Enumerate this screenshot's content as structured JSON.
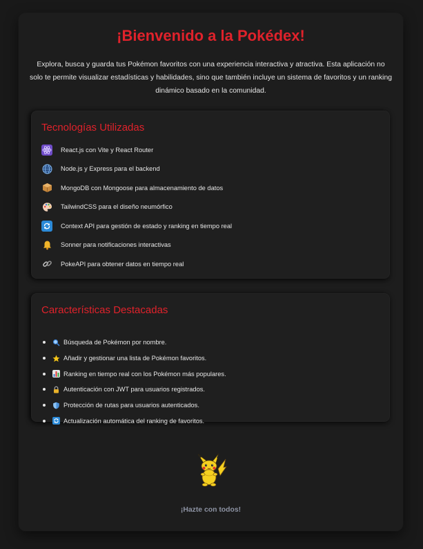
{
  "header": {
    "title": "¡Bienvenido a la Pokédex!",
    "intro": "Explora, busca y guarda tus Pokémon favoritos con una experiencia interactiva y atractiva. Esta aplicación no solo te permite visualizar estadísticas y habilidades, sino que también incluye un sistema de favoritos y un ranking dinámico basado en la comunidad."
  },
  "technologies": {
    "title": "Tecnologías Utilizadas",
    "items": [
      {
        "icon": "react-atom-icon",
        "text": "React.js con Vite y React Router"
      },
      {
        "icon": "globe-icon",
        "text": "Node.js y Express para el backend"
      },
      {
        "icon": "package-icon",
        "text": "MongoDB con Mongoose para almacenamiento de datos"
      },
      {
        "icon": "palette-icon",
        "text": "TailwindCSS para el diseño neumórfico"
      },
      {
        "icon": "refresh-icon",
        "text": "Context API para gestión de estado y ranking en tiempo real"
      },
      {
        "icon": "bell-icon",
        "text": "Sonner para notificaciones interactivas"
      },
      {
        "icon": "link-icon",
        "text": "PokeAPI para obtener datos en tiempo real"
      }
    ]
  },
  "features": {
    "title": "Características Destacadas",
    "items": [
      {
        "icon": "magnifier-icon",
        "text": "Búsqueda de Pokémon por nombre."
      },
      {
        "icon": "star-icon",
        "text": "Añadir y gestionar una lista de Pokémon favoritos."
      },
      {
        "icon": "bar-chart-icon",
        "text": "Ranking en tiempo real con los Pokémon más populares."
      },
      {
        "icon": "lock-icon",
        "text": "Autenticación con JWT para usuarios registrados."
      },
      {
        "icon": "shield-icon",
        "text": "Protección de rutas para usuarios autenticados."
      },
      {
        "icon": "refresh-icon",
        "text": "Actualización automática del ranking de favoritos."
      }
    ]
  },
  "footer": {
    "mascot_icon": "pikachu-icon",
    "text": "¡Hazte con todos!"
  },
  "colors": {
    "accent": "#e0222b",
    "background": "#191919",
    "card": "#1d1d1d",
    "text": "#e6e6e6",
    "muted": "#8d93a3"
  }
}
